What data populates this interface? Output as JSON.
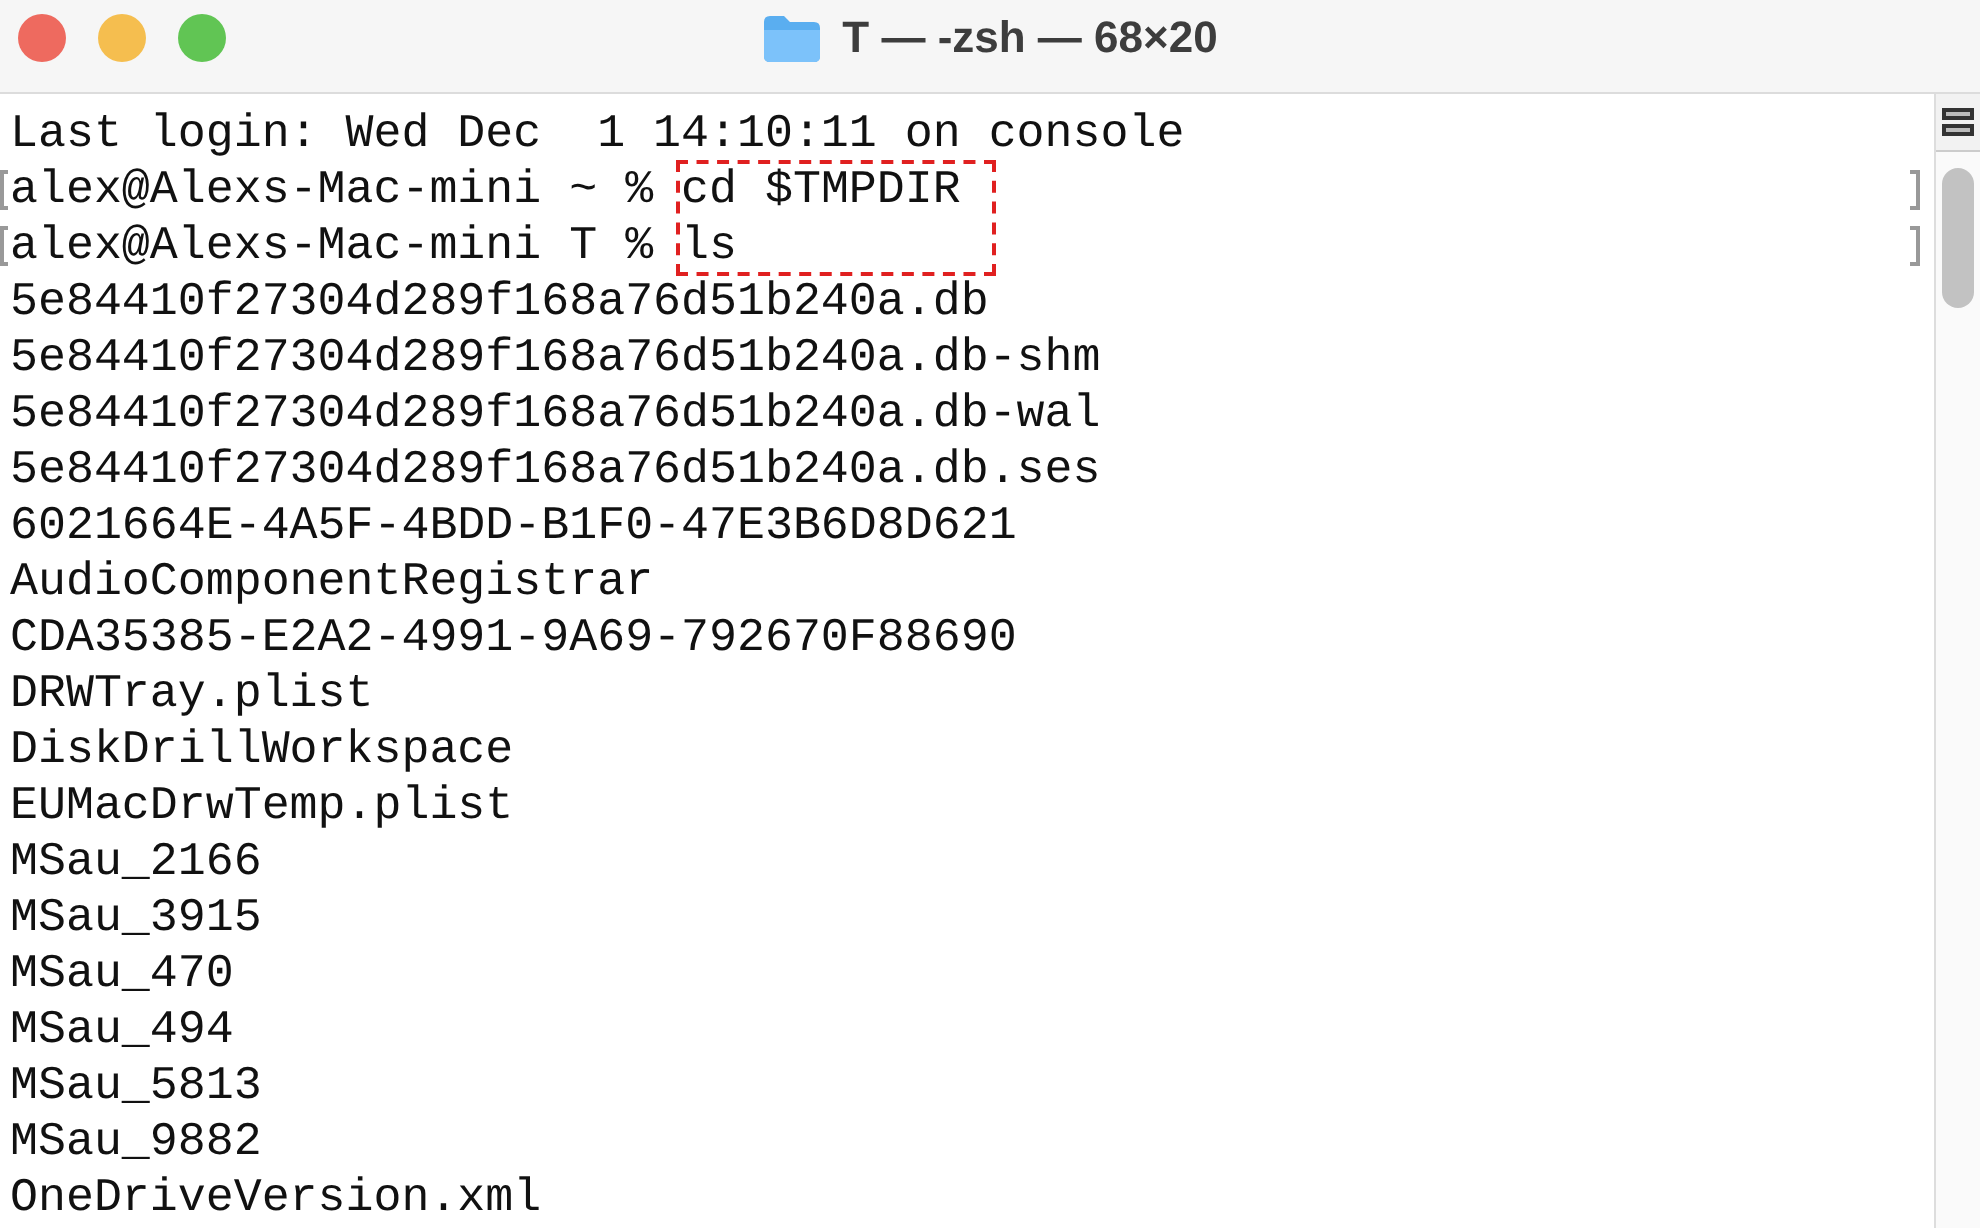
{
  "window": {
    "title": "T — -zsh — 68×20"
  },
  "lines": [
    {
      "kind": "output",
      "text": "Last login: Wed Dec  1 14:10:11 on console"
    },
    {
      "kind": "prompt",
      "prompt": "alex@Alexs-Mac-mini ~ %",
      "command": "cd $TMPDIR",
      "highlighted": true
    },
    {
      "kind": "prompt",
      "prompt": "alex@Alexs-Mac-mini T %",
      "command": "ls",
      "highlighted": true
    },
    {
      "kind": "output",
      "text": "5e84410f27304d289f168a76d51b240a.db"
    },
    {
      "kind": "output",
      "text": "5e84410f27304d289f168a76d51b240a.db-shm"
    },
    {
      "kind": "output",
      "text": "5e84410f27304d289f168a76d51b240a.db-wal"
    },
    {
      "kind": "output",
      "text": "5e84410f27304d289f168a76d51b240a.db.ses"
    },
    {
      "kind": "output",
      "text": "6021664E-4A5F-4BDD-B1F0-47E3B6D8D621"
    },
    {
      "kind": "output",
      "text": "AudioComponentRegistrar"
    },
    {
      "kind": "output",
      "text": "CDA35385-E2A2-4991-9A69-792670F88690"
    },
    {
      "kind": "output",
      "text": "DRWTray.plist"
    },
    {
      "kind": "output",
      "text": "DiskDrillWorkspace"
    },
    {
      "kind": "output",
      "text": "EUMacDrwTemp.plist"
    },
    {
      "kind": "output",
      "text": "MSau_2166"
    },
    {
      "kind": "output",
      "text": "MSau_3915"
    },
    {
      "kind": "output",
      "text": "MSau_470"
    },
    {
      "kind": "output",
      "text": "MSau_494"
    },
    {
      "kind": "output",
      "text": "MSau_5813"
    },
    {
      "kind": "output",
      "text": "MSau_9882"
    },
    {
      "kind": "output",
      "text": "OneDriveVersion.xml"
    }
  ]
}
